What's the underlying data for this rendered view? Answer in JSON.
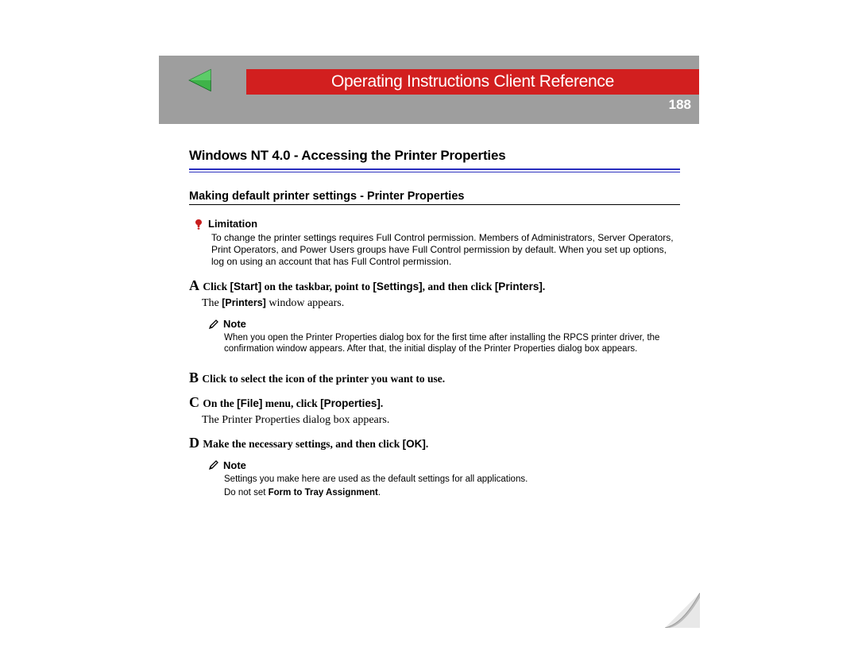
{
  "header": {
    "title_heavy": "Operating Instructions",
    "title_light": "Client Reference",
    "page_number": "188"
  },
  "doc": {
    "h1": "Windows NT 4.0 - Accessing the Printer Properties",
    "h2": "Making default printer settings - Printer Properties",
    "limitation": {
      "label": "Limitation",
      "text": "To change the printer settings requires Full Control permission. Members of Administrators, Server Operators, Print Operators, and Power Users groups have Full Control permission by default. When you set up options, log on using an account that has Full Control permission."
    },
    "steps": {
      "A": {
        "marker": "A",
        "pre": "Click ",
        "b1": "[Start]",
        "mid1": " on the taskbar, point to ",
        "b2": "[Settings]",
        "mid2": ", and then click ",
        "b3": "[Printers]",
        "post": "."
      },
      "A_after_pre": "The ",
      "A_after_bold": "[Printers]",
      "A_after_post": " window appears.",
      "note1": {
        "label": "Note",
        "text": "When you open the Printer Properties dialog box for the first time after installing the RPCS printer driver, the confirmation window appears. After that, the initial display of the Printer Properties dialog box appears."
      },
      "B": {
        "marker": "B",
        "text": " Click to select the icon of the printer you want to use."
      },
      "C": {
        "marker": "C",
        "pre": " On the ",
        "b1": "[File]",
        "mid1": " menu, click ",
        "b2": "[Properties]",
        "post": "."
      },
      "C_after": "The Printer Properties dialog box appears.",
      "D": {
        "marker": "D",
        "pre": "Make the necessary settings, and then click ",
        "b1": "[OK]",
        "post": "."
      },
      "note2": {
        "label": "Note",
        "line1": "Settings you make here are used as the default settings for all applications.",
        "line2_pre": "Do not set ",
        "line2_bold": "Form to Tray Assignment",
        "line2_post": "."
      }
    }
  }
}
